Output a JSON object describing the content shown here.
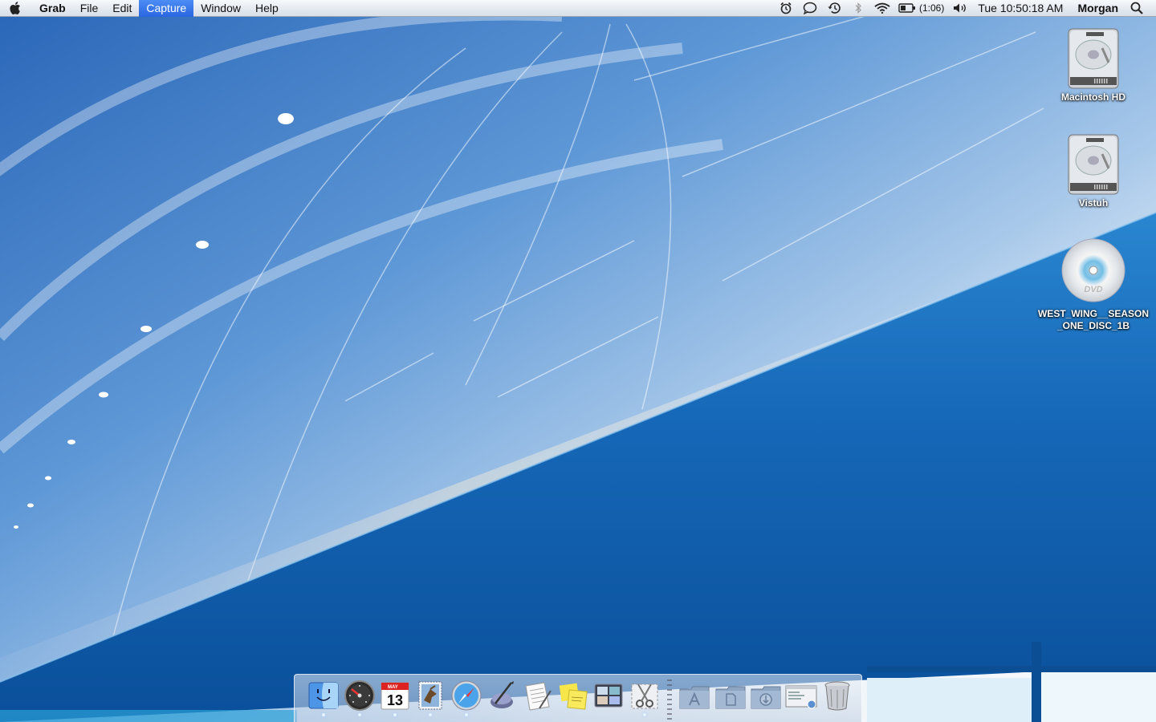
{
  "menubar": {
    "app_name": "Grab",
    "menus": [
      "File",
      "Edit",
      "Capture",
      "Window",
      "Help"
    ],
    "active_menu": "Capture",
    "battery_time": "(1:06)",
    "clock": "Tue 10:50:18 AM",
    "user": "Morgan",
    "status_icons": [
      "alarm-clock-icon",
      "ichat-bubble-icon",
      "time-machine-icon",
      "bluetooth-icon",
      "wifi-icon",
      "battery-icon",
      "volume-icon",
      "spotlight-icon"
    ]
  },
  "desktop": {
    "icons": [
      {
        "label": "Macintosh HD",
        "type": "hard-drive"
      },
      {
        "label": "Vistuh",
        "type": "hard-drive"
      },
      {
        "label": "WEST_WING__SEASON_ONE_DISC_1B",
        "type": "dvd"
      }
    ]
  },
  "dock": {
    "apps": [
      {
        "name": "finder",
        "running": true
      },
      {
        "name": "dashboard",
        "running": true
      },
      {
        "name": "ical",
        "running": true,
        "date": "13",
        "month": "MAY"
      },
      {
        "name": "mail",
        "running": true
      },
      {
        "name": "safari",
        "running": true
      },
      {
        "name": "script-editor",
        "running": false
      },
      {
        "name": "textedit",
        "running": false
      },
      {
        "name": "stickies",
        "running": false
      },
      {
        "name": "spaces",
        "running": false
      },
      {
        "name": "grab",
        "running": true
      }
    ],
    "stacks": [
      "applications-folder",
      "documents-folder",
      "downloads-folder",
      "screenshot-document",
      "trash"
    ]
  }
}
